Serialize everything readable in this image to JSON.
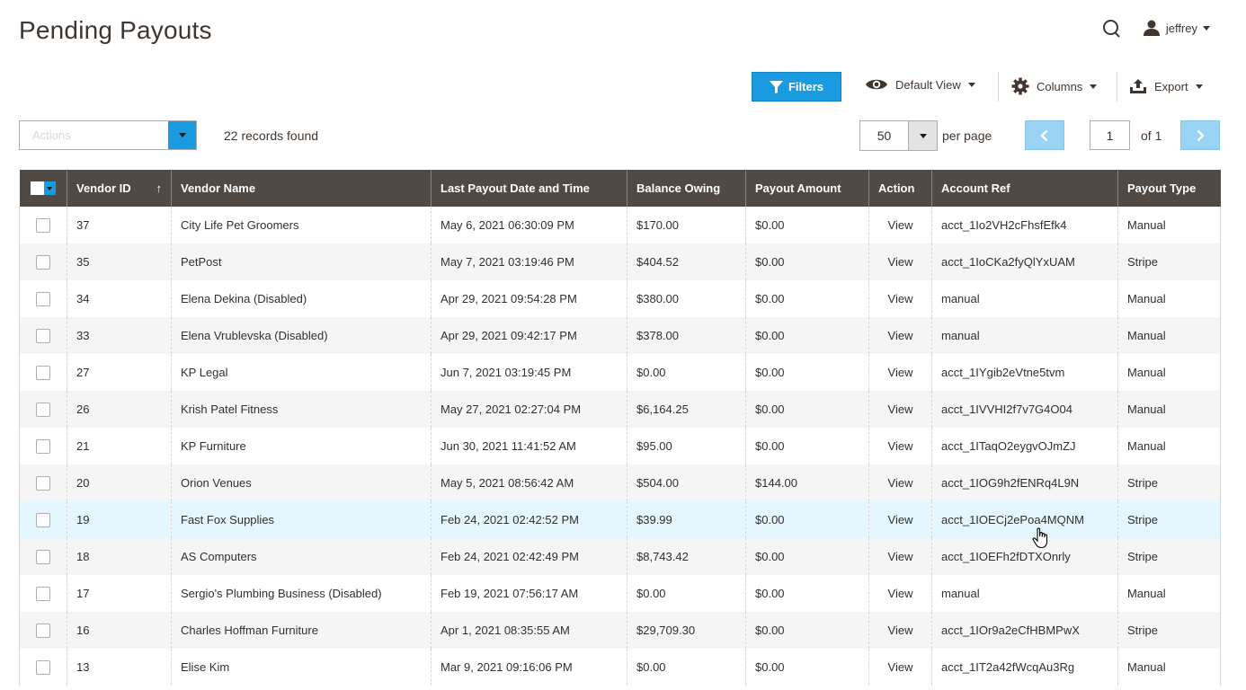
{
  "page": {
    "title": "Pending Payouts"
  },
  "header": {
    "user_name": "jeffrey"
  },
  "toolbar": {
    "filters_label": "Filters",
    "view_label": "Default View",
    "columns_label": "Columns",
    "export_label": "Export"
  },
  "grid_controls": {
    "actions_placeholder": "Actions",
    "records_found": "22 records found",
    "per_page_value": "50",
    "per_page_label": "per page",
    "current_page": "1",
    "of_pages": "of 1"
  },
  "colors": {
    "accent": "#1a9be0",
    "header_bg": "#514943",
    "link": "#007bdb"
  },
  "table": {
    "columns": {
      "vendor_id": "Vendor ID",
      "vendor_name": "Vendor Name",
      "last_payout": "Last Payout Date and Time",
      "balance": "Balance Owing",
      "payout_amount": "Payout Amount",
      "action": "Action",
      "account_ref": "Account Ref",
      "payout_type": "Payout Type"
    },
    "sort_indicator": "↑",
    "rows": [
      {
        "id": "37",
        "name": "City Life Pet Groomers",
        "last": "May 6, 2021 06:30:09 PM",
        "balance": "$170.00",
        "payout": "$0.00",
        "action": "View",
        "ref": "acct_1Io2VH2cFhsfEfk4",
        "type": "Manual"
      },
      {
        "id": "35",
        "name": "PetPost",
        "last": "May 7, 2021 03:19:46 PM",
        "balance": "$404.52",
        "payout": "$0.00",
        "action": "View",
        "ref": "acct_1IoCKa2fyQlYxUAM",
        "type": "Stripe"
      },
      {
        "id": "34",
        "name": "Elena Dekina (Disabled)",
        "last": "Apr 29, 2021 09:54:28 PM",
        "balance": "$380.00",
        "payout": "$0.00",
        "action": "View",
        "ref": "manual",
        "type": "Manual"
      },
      {
        "id": "33",
        "name": "Elena Vrublevska (Disabled)",
        "last": "Apr 29, 2021 09:42:17 PM",
        "balance": "$378.00",
        "payout": "$0.00",
        "action": "View",
        "ref": "manual",
        "type": "Manual"
      },
      {
        "id": "27",
        "name": "KP Legal",
        "last": "Jun 7, 2021 03:19:45 PM",
        "balance": "$0.00",
        "payout": "$0.00",
        "action": "View",
        "ref": "acct_1IYgib2eVtne5tvm",
        "type": "Manual"
      },
      {
        "id": "26",
        "name": "Krish Patel Fitness",
        "last": "May 27, 2021 02:27:04 PM",
        "balance": "$6,164.25",
        "payout": "$0.00",
        "action": "View",
        "ref": "acct_1IVVHI2f7v7G4O04",
        "type": "Manual"
      },
      {
        "id": "21",
        "name": "KP Furniture",
        "last": "Jun 30, 2021 11:41:52 AM",
        "balance": "$95.00",
        "payout": "$0.00",
        "action": "View",
        "ref": "acct_1ITaqO2eygvOJmZJ",
        "type": "Manual"
      },
      {
        "id": "20",
        "name": "Orion Venues",
        "last": "May 5, 2021 08:56:42 AM",
        "balance": "$504.00",
        "payout": "$144.00",
        "action": "View",
        "ref": "acct_1IOG9h2fENRq4L9N",
        "type": "Stripe"
      },
      {
        "id": "19",
        "name": "Fast Fox Supplies",
        "last": "Feb 24, 2021 02:42:52 PM",
        "balance": "$39.99",
        "payout": "$0.00",
        "action": "View",
        "ref": "acct_1IOECj2ePoa4MQNM",
        "type": "Stripe"
      },
      {
        "id": "18",
        "name": "AS Computers",
        "last": "Feb 24, 2021 02:42:49 PM",
        "balance": "$8,743.42",
        "payout": "$0.00",
        "action": "View",
        "ref": "acct_1IOEFh2fDTXOnrly",
        "type": "Stripe"
      },
      {
        "id": "17",
        "name": "Sergio's Plumbing Business (Disabled)",
        "last": "Feb 19, 2021 07:56:17 AM",
        "balance": "$0.00",
        "payout": "$0.00",
        "action": "View",
        "ref": "manual",
        "type": "Manual"
      },
      {
        "id": "16",
        "name": "Charles Hoffman Furniture",
        "last": "Apr 1, 2021 08:35:55 AM",
        "balance": "$29,709.30",
        "payout": "$0.00",
        "action": "View",
        "ref": "acct_1IOr9a2eCfHBMPwX",
        "type": "Stripe"
      },
      {
        "id": "13",
        "name": "Elise Kim",
        "last": "Mar 9, 2021 09:16:06 PM",
        "balance": "$0.00",
        "payout": "$0.00",
        "action": "View",
        "ref": "acct_1IT2a42fWcqAu3Rg",
        "type": "Manual"
      }
    ]
  }
}
